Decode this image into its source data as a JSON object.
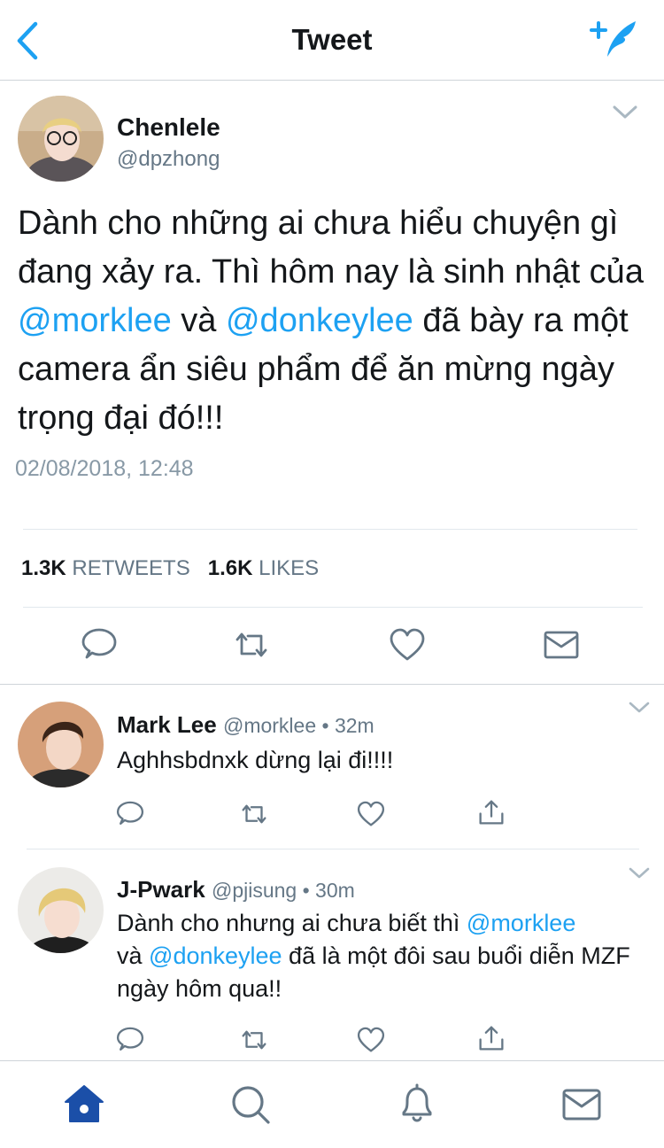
{
  "header": {
    "title": "Tweet",
    "back_icon": "chevron-left-icon",
    "compose_icon": "compose-tweet-icon",
    "accent": "#1da1f2"
  },
  "tweet": {
    "name": "Chenlele",
    "handle": "@dpzhong",
    "text_parts": [
      "Dành cho những ai chưa hiểu chuyện gì đang xảy ra. Thì hôm nay là sinh nhật của ",
      "@morklee",
      " và ",
      "@donkeylee",
      " đã bày ra một camera ẩn siêu phẩm để ăn mừng ngày trọng đại đó!!!"
    ],
    "timestamp": "02/08/2018, 12:48",
    "retweets_count": "1.3K",
    "retweets_label": "RETWEETS",
    "likes_count": "1.6K",
    "likes_label": "LIKES"
  },
  "replies": [
    {
      "name": "Mark Lee",
      "meta": "@morklee • 32m",
      "text_parts": [
        "Aghhsbdnxk dừng lại đi!!!!"
      ]
    },
    {
      "name": "J-Pwark",
      "meta": "@pjisung • 30m",
      "text_parts": [
        "Dành cho nhưng ai chưa biết thì ",
        "@morklee",
        " và ",
        "@donkeylee",
        " đã là một đôi sau buổi diễn MZF ngày hôm qua!!"
      ]
    }
  ],
  "tabbar": {
    "items": [
      "home-icon",
      "search-icon",
      "notifications-icon",
      "messages-icon"
    ],
    "active": "home-icon"
  },
  "colors": {
    "accent": "#1da1f2",
    "text": "#14171a",
    "secondary": "#657786",
    "icon": "#657786",
    "home_active": "#1b4fa8"
  }
}
